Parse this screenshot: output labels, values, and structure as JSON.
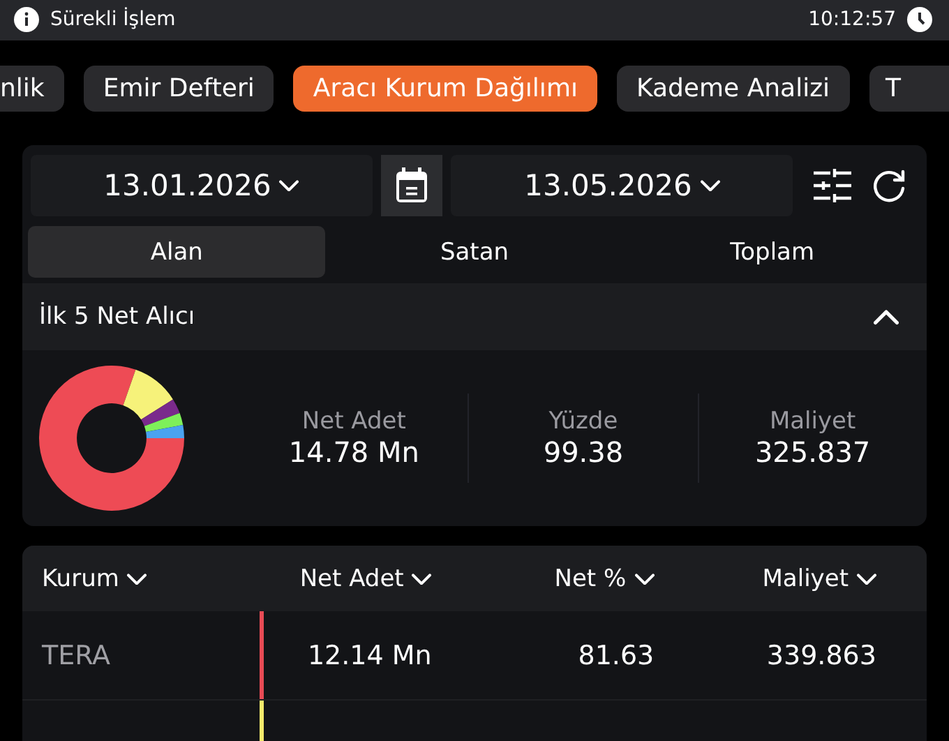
{
  "status_bar": {
    "title": "Sürekli İşlem",
    "time": "10:12:57"
  },
  "tabs": [
    {
      "label": "nlik",
      "selected": false,
      "kind": "partial"
    },
    {
      "label": "Emir Defteri",
      "selected": false,
      "kind": "full"
    },
    {
      "label": "Aracı Kurum Dağılımı",
      "selected": true,
      "kind": "full"
    },
    {
      "label": "Kademe Analizi",
      "selected": false,
      "kind": "full"
    },
    {
      "label": "T",
      "selected": false,
      "kind": "partial"
    }
  ],
  "date_range": {
    "start": "13.01.2026",
    "end": "13.05.2026"
  },
  "segments": [
    {
      "label": "Alan",
      "selected": true
    },
    {
      "label": "Satan",
      "selected": false
    },
    {
      "label": "Toplam",
      "selected": false
    }
  ],
  "section": {
    "title": "İlk 5 Net Alıcı",
    "expanded": true
  },
  "summary": [
    {
      "label": "Net Adet",
      "value": "14.78 Mn"
    },
    {
      "label": "Yüzde",
      "value": "99.38"
    },
    {
      "label": "Maliyet",
      "value": "325.837"
    }
  ],
  "table": {
    "columns": [
      "Kurum",
      "Net Adet",
      "Net %",
      "Maliyet"
    ],
    "rows": [
      {
        "cells": [
          "TERA",
          "12.14 Mn",
          "81.63",
          "339.863"
        ],
        "color": "#e84b55"
      },
      {
        "color": "#f4ea6c"
      }
    ]
  }
}
